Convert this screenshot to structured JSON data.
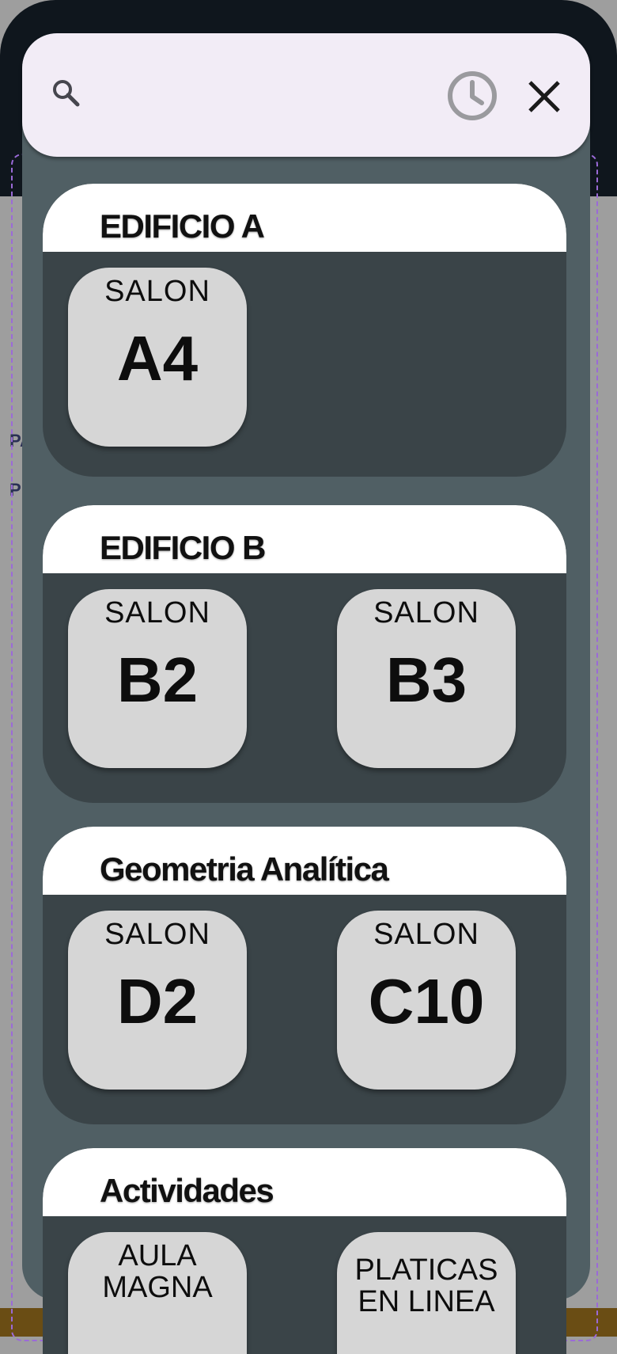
{
  "search": {
    "search_icon": "search-icon",
    "history_icon": "clock-icon",
    "close_icon": "close-icon"
  },
  "background": {
    "line1": "PA",
    "line2": "PE"
  },
  "sections": [
    {
      "title": "EDIFICIO A",
      "tiles": [
        {
          "label": "SALON",
          "room": "A4"
        }
      ]
    },
    {
      "title": "EDIFICIO B",
      "tiles": [
        {
          "label": "SALON",
          "room": "B2"
        },
        {
          "label": "SALON",
          "room": "B3"
        }
      ]
    },
    {
      "title": "Geometria Analítica",
      "tiles": [
        {
          "label": "SALON",
          "room": "D2"
        },
        {
          "label": "SALON",
          "room": "C10"
        }
      ]
    },
    {
      "title": "Actividades",
      "tiles": [
        {
          "line1": "AULA",
          "line2": "MAGNA"
        },
        {
          "line1": "PLATICAS",
          "line2": "EN LINEA"
        }
      ]
    }
  ],
  "colors": {
    "panel": "#505f64",
    "section_body": "#3a4448",
    "tile": "#d6d6d6",
    "search_bg": "#f2ecf6"
  }
}
